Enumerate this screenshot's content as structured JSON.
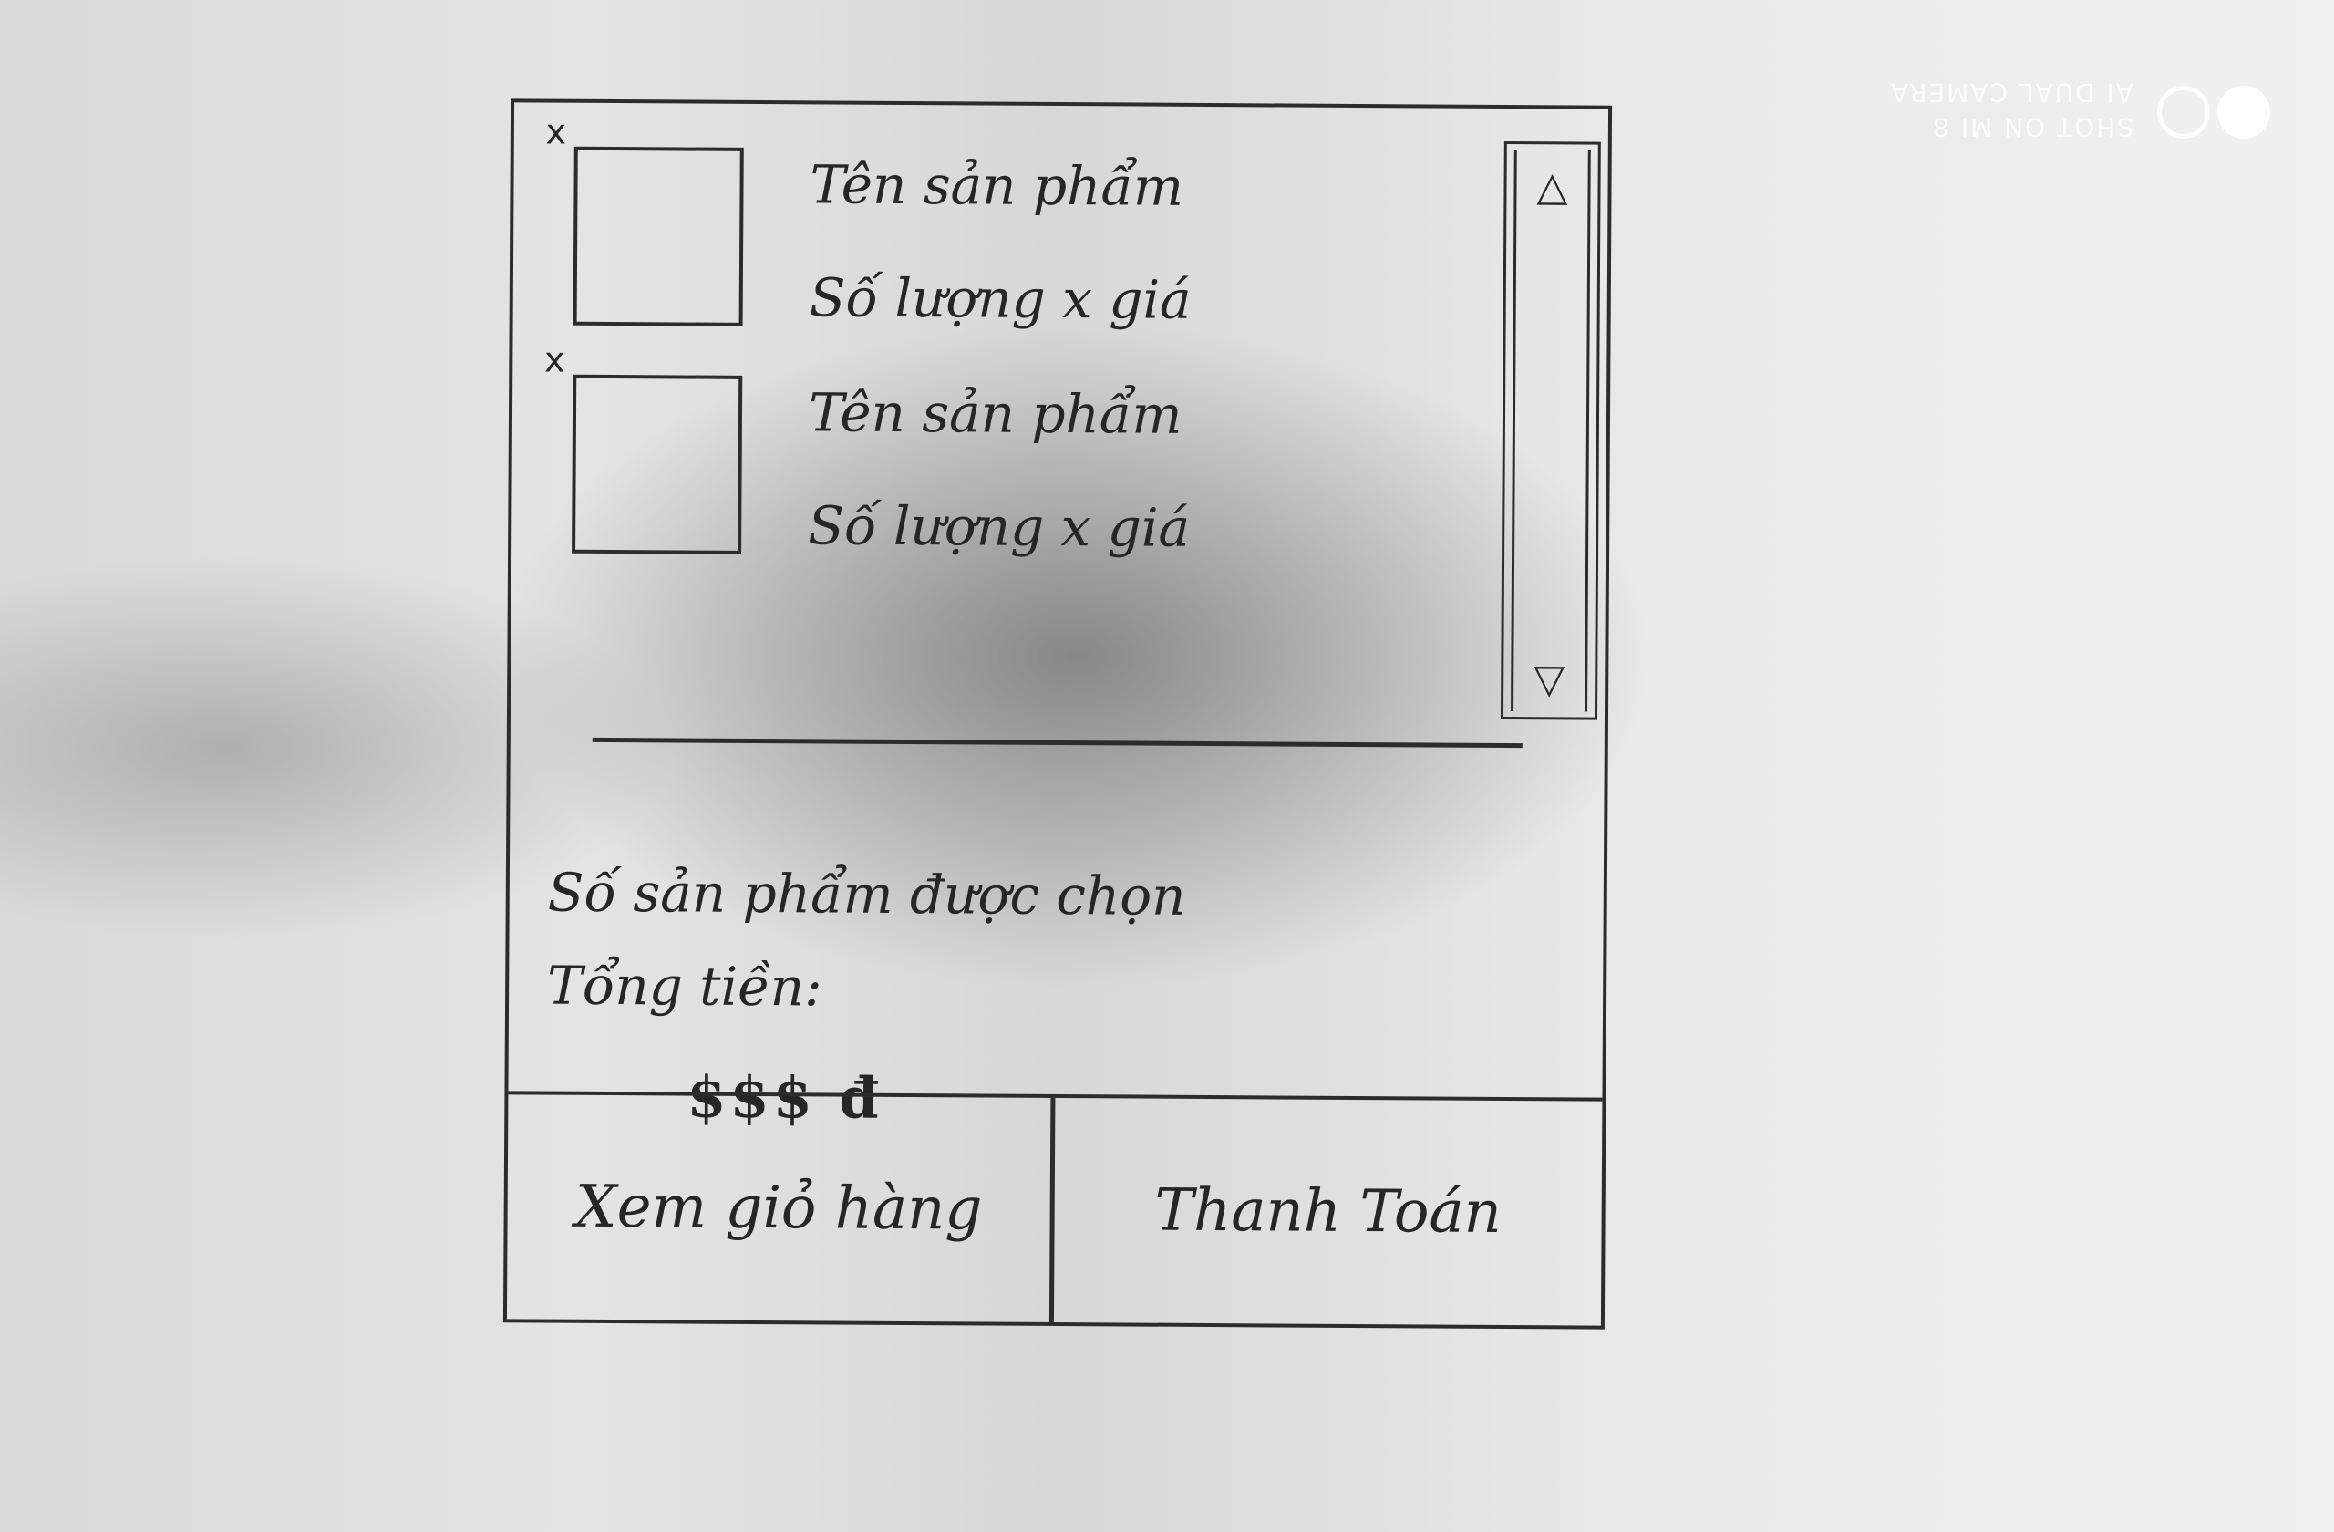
{
  "watermark": {
    "line1": "SHOT ON MI 8",
    "line2": "AI DUAL CAMERA"
  },
  "cart": {
    "items": [
      {
        "remove": "x",
        "name": "Tên sản phẩm",
        "qty_price": "Số lượng x giá"
      },
      {
        "remove": "x",
        "name": "Tên sản phẩm",
        "qty_price": "Số lượng x giá"
      }
    ],
    "scroll": {
      "up": "△",
      "down": "▽"
    }
  },
  "summary": {
    "selected_count_label": "Số sản phẩm được chọn",
    "total_label": "Tổng tiền:",
    "total_value": "$$$ đ"
  },
  "actions": {
    "view_cart": "Xem giỏ hàng",
    "checkout": "Thanh Toán"
  }
}
